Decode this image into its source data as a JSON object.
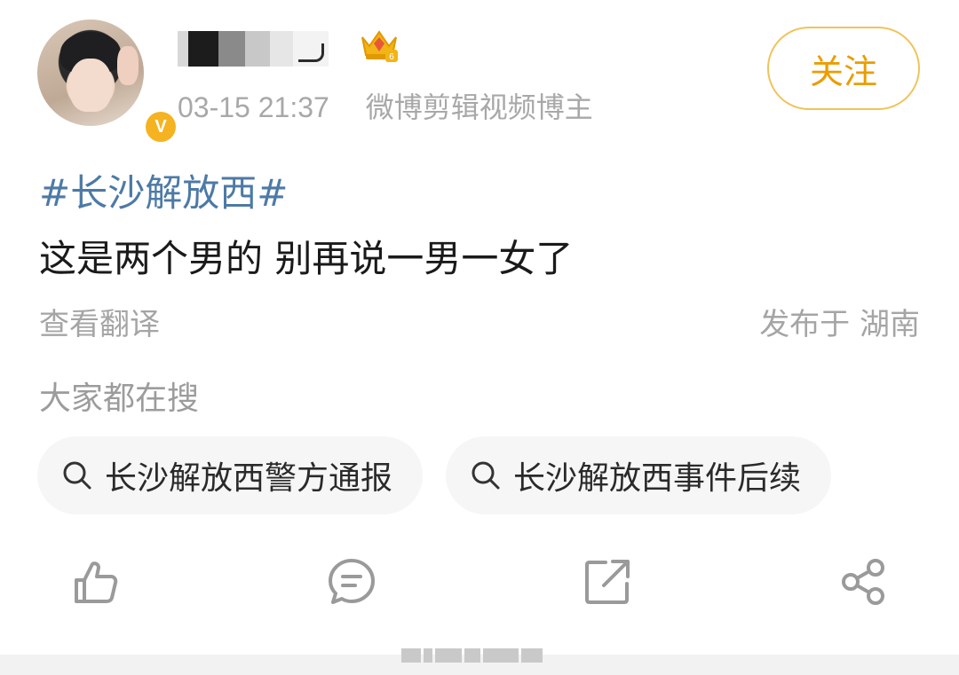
{
  "post": {
    "timestamp": "03-15 21:37",
    "user_tag": "微博剪辑视频博主",
    "follow_label": "关注",
    "verified_mark": "V",
    "hashtag": "#长沙解放西#",
    "text": "这是两个男的 别再说一男一女了",
    "translate_label": "查看翻译",
    "location": "发布于 湖南"
  },
  "trending": {
    "title": "大家都在搜",
    "items": [
      {
        "label": "长沙解放西警方通报"
      },
      {
        "label": "长沙解放西事件后续"
      }
    ]
  },
  "actions": {
    "icons": [
      "like-icon",
      "comment-icon",
      "repost-icon",
      "share-icon"
    ]
  },
  "colors": {
    "accent": "#ea9d00",
    "hashtag": "#4d7aa6",
    "badge": "#f5b321"
  }
}
